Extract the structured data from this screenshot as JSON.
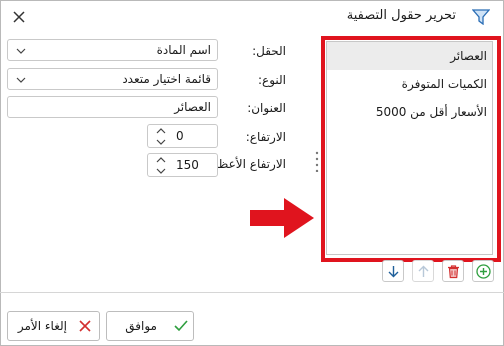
{
  "window": {
    "title": "تحرير حقول التصفية",
    "icon": "filter-icon",
    "close_icon": "close-icon"
  },
  "filter_list": {
    "items": [
      {
        "label": "العصائر",
        "selected": true
      },
      {
        "label": "الكميات المتوفرة",
        "selected": false
      },
      {
        "label": "الأسعار أقل من 5000",
        "selected": false
      }
    ],
    "highlight_color": "#e0141e"
  },
  "list_toolbar": {
    "add_icon": "add-circle-icon",
    "delete_icon": "delete-icon",
    "move_up_icon": "arrow-up-icon",
    "move_down_icon": "arrow-down-icon"
  },
  "form": {
    "field": {
      "label": "الحقل:",
      "value": "اسم المادة"
    },
    "type": {
      "label": "النوع:",
      "value": "قائمة اختيار متعدد"
    },
    "caption": {
      "label": "العنوان:",
      "value": "العصائر"
    },
    "height": {
      "label": "الارتفاع:",
      "value": "0"
    },
    "max_height": {
      "label": "الارتفاع الأعظمي:",
      "value": "150"
    }
  },
  "buttons": {
    "ok": {
      "label": "موافق",
      "icon": "check-icon",
      "color": "#2e9e3e"
    },
    "cancel": {
      "label": "إلغاء الأمر",
      "icon": "x-icon",
      "color": "#d32f2f"
    }
  }
}
